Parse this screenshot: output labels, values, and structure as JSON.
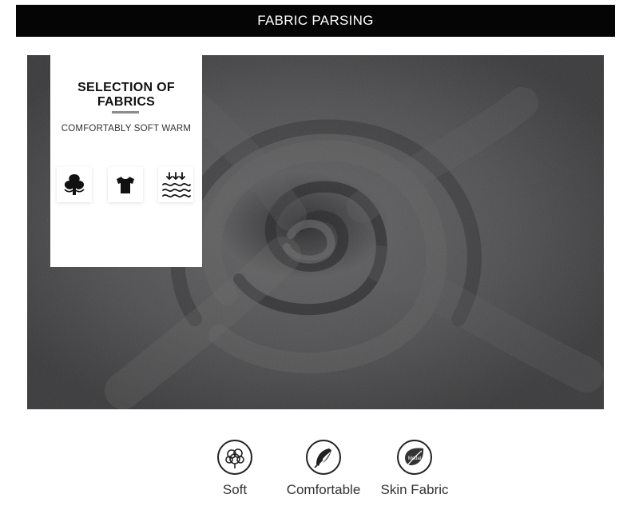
{
  "header": {
    "title": "FABRIC PARSING"
  },
  "panel": {
    "title": "SELECTION OF FABRICS",
    "subtitle": "COMFORTABLY SOFT WARM",
    "icons": [
      "tree-icon",
      "tshirt-icon",
      "water-wave-icon"
    ]
  },
  "features": [
    {
      "label": "Soft",
      "icon": "cotton-icon"
    },
    {
      "label": "Comfortable",
      "icon": "feather-icon"
    },
    {
      "label": "Skin Fabric",
      "icon": "leaf-icon",
      "icon_text": "Modal"
    }
  ],
  "colors": {
    "header_bg": "#050505",
    "fabric": "#3a3a3c",
    "panel_bg": "#ffffff",
    "text": "#333333"
  }
}
